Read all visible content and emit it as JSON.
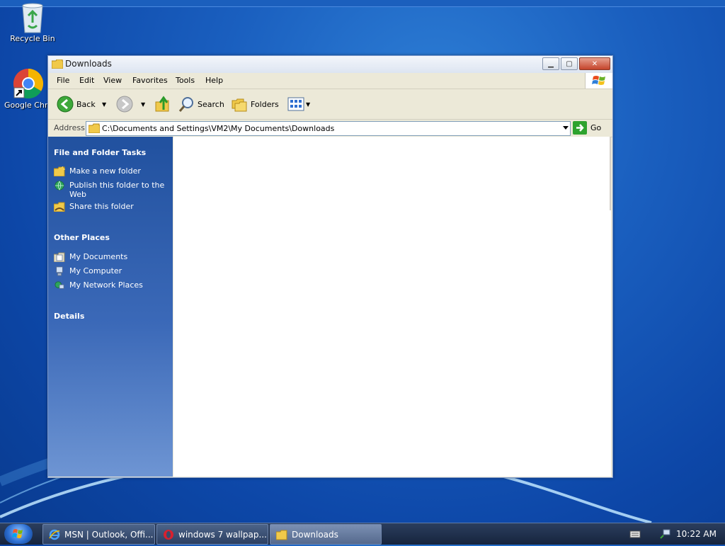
{
  "desktop": {
    "icons": [
      {
        "label": "Recycle Bin",
        "icon": "recycle-bin-icon"
      },
      {
        "label": "Google Chro",
        "icon": "chrome-icon"
      }
    ]
  },
  "window": {
    "title": "Downloads",
    "menu": [
      "File",
      "Edit",
      "View",
      "Favorites",
      "Tools",
      "Help"
    ],
    "toolbar": {
      "back_label": "Back",
      "search_label": "Search",
      "folders_label": "Folders"
    },
    "address": {
      "label": "Address",
      "path": "C:\\Documents and Settings\\VM2\\My Documents\\Downloads",
      "go_label": "Go"
    },
    "taskpane": {
      "file_tasks_title": "File and Folder Tasks",
      "file_tasks": [
        "Make a new folder",
        "Publish this folder to the Web",
        "Share this folder"
      ],
      "other_places_title": "Other Places",
      "other_places": [
        "My Documents",
        "My Computer",
        "My Network Places"
      ],
      "details_title": "Details"
    }
  },
  "taskbar": {
    "tasks": [
      {
        "label": "MSN | Outlook, Offi...",
        "icon": "ie-icon"
      },
      {
        "label": "windows 7 wallpap...",
        "icon": "opera-icon"
      },
      {
        "label": "Downloads",
        "icon": "folder-icon"
      }
    ],
    "clock": "10:22 AM"
  },
  "colors": {
    "taskpane_top": "#21519f",
    "taskpane_bottom": "#6e95d3",
    "desktop": "#1a5fbf"
  }
}
